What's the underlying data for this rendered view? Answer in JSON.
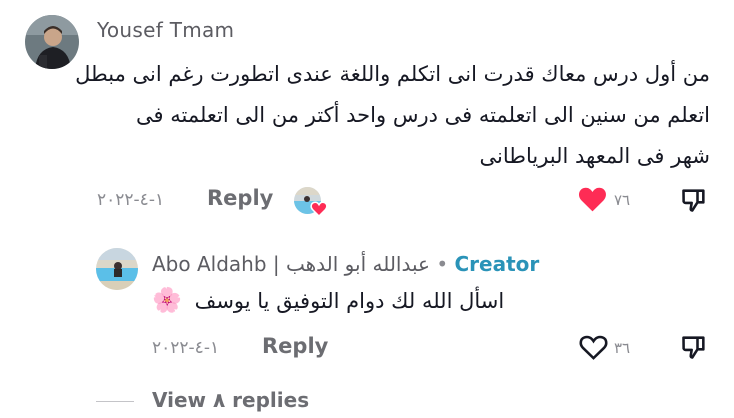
{
  "comment": {
    "username": "Yousef Tmam",
    "lines": [
      "من أول درس معاك قدرت انى اتكلم واللغة عندى اتطورت رغم انى مبطل",
      "اتعلم من سنين الى اتعلمته فى درس واحد أكتر من الى اتعلمته فى",
      "شهر فى المعهد البرياطانى"
    ],
    "date": "١-٤-٢٠٢٢",
    "reply_label": "Reply",
    "like_count": "٧٦",
    "liked": true,
    "accent_color": "#fe2c55"
  },
  "reply": {
    "author_name": "Abo Aldahb | عبدالله أبو الدهب",
    "separator": "•",
    "badge": "Creator",
    "text": "اسأل الله لك دوام التوفيق يا يوسف",
    "emoji": "🌸",
    "date": "١-٤-٢٠٢٢",
    "reply_label": "Reply",
    "like_count": "٣٦",
    "liked": false,
    "badge_color": "#2a93b8"
  },
  "view_replies": {
    "label": "View ٨ replies"
  },
  "icons": {
    "heart_filled": "heart-filled-icon",
    "heart_outline": "heart-outline-icon",
    "dislike": "thumbs-down-icon",
    "creator_liked": "creator-liked-heart-icon"
  }
}
